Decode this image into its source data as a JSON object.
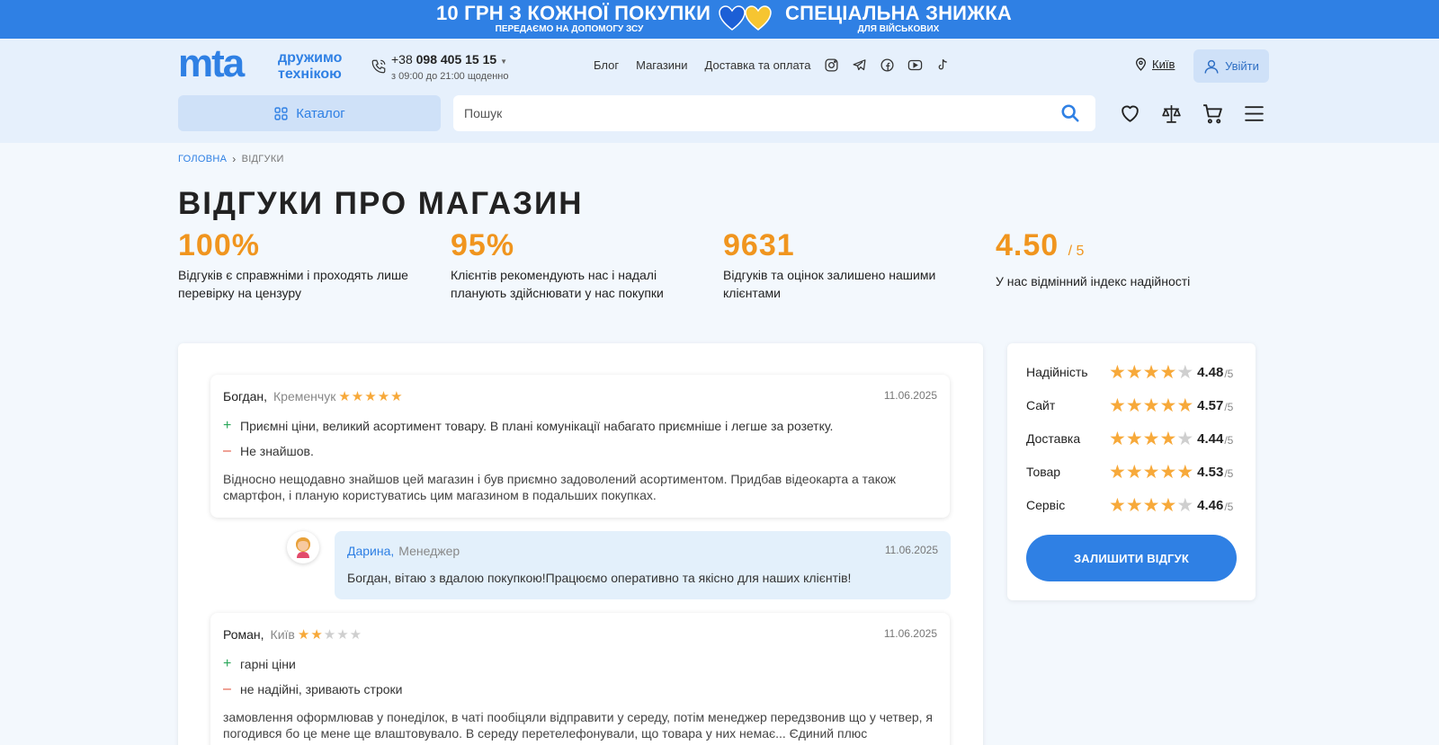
{
  "promo": {
    "left_title": "10 ГРН З КОЖНОЇ ПОКУПКИ",
    "left_sub": "ПЕРЕДАЄМО НА ДОПОМОГУ ЗСУ",
    "right_title": "СПЕЦІАЛЬНА ЗНИЖКА",
    "right_sub": "ДЛЯ ВІЙСЬКОВИХ",
    "background": "#2f80e4"
  },
  "header": {
    "logo_mark": "mta",
    "logo_tag_line1": "дружимо",
    "logo_tag_line2": "технікою",
    "phone_prefix": "+38",
    "phone_number": "098 405 15 15",
    "phone_hours": "з 09:00 до 21:00 щоденно",
    "nav": [
      "Блог",
      "Магазини",
      "Доставка та оплата"
    ],
    "social_icons": [
      "instagram-icon",
      "telegram-icon",
      "facebook-icon",
      "youtube-icon",
      "tiktok-icon"
    ],
    "city": "Київ",
    "login_label": "Увійти",
    "catalog_label": "Каталог",
    "search_placeholder": "Пошук",
    "action_icons": [
      "heart-icon",
      "compare-icon",
      "cart-icon",
      "menu-icon"
    ]
  },
  "breadcrumb": {
    "home": "ГОЛОВНА",
    "separator": "›",
    "current": "ВІДГУКИ"
  },
  "page_title": "ВІДГУКИ ПРО МАГАЗИН",
  "stats": [
    {
      "value": "100%",
      "suffix": "",
      "desc": "Відгуків є справжніми і проходять лише перевірку на цензуру"
    },
    {
      "value": "95%",
      "suffix": "",
      "desc": "Клієнтів рекомендують нас і надалі планують здійснювати у нас покупки"
    },
    {
      "value": "9631",
      "suffix": "",
      "desc": "Відгуків та оцінок залишено нашими клієнтами"
    },
    {
      "value": "4.50",
      "suffix": "/ 5",
      "desc": "У нас відмінний індекс надійності"
    }
  ],
  "reviews": [
    {
      "name": "Богдан,",
      "city": "Кременчук",
      "stars": 5,
      "date": "11.06.2025",
      "pros": "Приємні ціни, великий асортимент товару. В плані комунікації набагато приємніше і легше за розетку.",
      "cons": "Не знайшов.",
      "text": "Відносно нещодавно знайшов цей магазин і був приємно задоволений асортиментом. Придбав відеокарта а також смартфон, і планую користуватись цим магазином в подальших покупках."
    },
    {
      "name": "Роман,",
      "city": "Київ",
      "stars": 2,
      "date": "11.06.2025",
      "pros": "гарні ціни",
      "cons": "не надійні, зривають строки",
      "text": "замовлення оформлював у понеділок, в чаті пообіцяли відправити у середу, потім менеджер передзвонив що у четвер, я погодився бо це мене ще влаштовувало. В середу перетелефонували, що товара у них немає... Єдиний плюс"
    }
  ],
  "reply": {
    "name": "Дарина,",
    "role": "Менеджер",
    "date": "11.06.2025",
    "text": "Богдан, вітаю з вдалою покупкою!Працюємо оперативно та якісно для наших клієнтів!"
  },
  "ratings": [
    {
      "label": "Надійність",
      "value": "4.48",
      "max": "/5",
      "stars": 4
    },
    {
      "label": "Сайт",
      "value": "4.57",
      "max": "/5",
      "stars": 5
    },
    {
      "label": "Доставка",
      "value": "4.44",
      "max": "/5",
      "stars": 4
    },
    {
      "label": "Товар",
      "value": "4.53",
      "max": "/5",
      "stars": 5
    },
    {
      "label": "Сервіс",
      "value": "4.46",
      "max": "/5",
      "stars": 4
    }
  ],
  "leave_review_label": "ЗАЛИШИТИ ВІДГУК",
  "colors": {
    "accent": "#2f80e4",
    "stat_orange": "#f0951e",
    "star": "#f7a93a"
  }
}
